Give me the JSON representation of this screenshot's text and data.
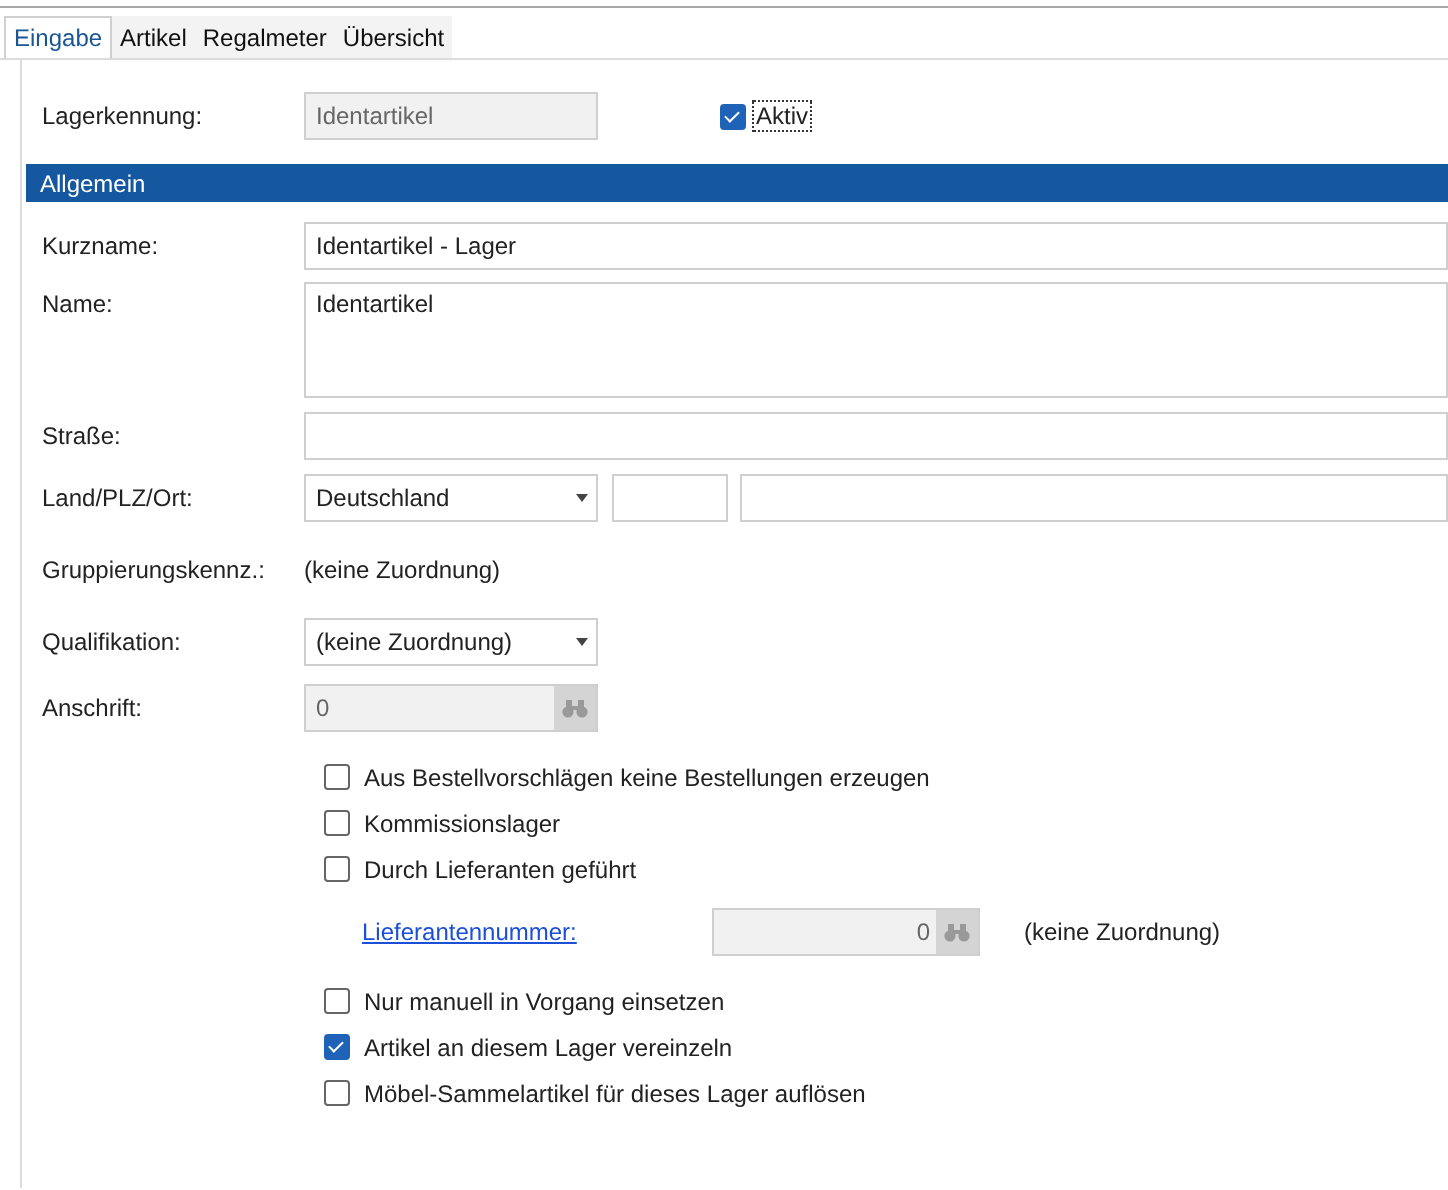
{
  "tabs": [
    {
      "label": "Eingabe",
      "selected": true
    },
    {
      "label": "Artikel",
      "selected": false
    },
    {
      "label": "Regalmeter",
      "selected": false
    },
    {
      "label": "Übersicht",
      "selected": false
    }
  ],
  "lagerkennung": {
    "label": "Lagerkennung:",
    "value": "Identartikel",
    "disabled": true
  },
  "aktiv": {
    "label": "Aktiv",
    "checked": true
  },
  "section": {
    "title": "Allgemein"
  },
  "fields": [
    {
      "kind": "text",
      "label": "Kurzname:",
      "value": "Identartikel - Lager"
    },
    {
      "kind": "textarea",
      "label": "Name:",
      "value": "Identartikel"
    },
    {
      "kind": "text",
      "label": "Straße:"
    },
    {
      "kind": "address",
      "label": "Land/PLZ/Ort:",
      "value": "Deutschland"
    },
    {
      "kind": "static",
      "label": "Gruppierungskennz.:",
      "value": "(keine Zuordnung)"
    },
    {
      "kind": "select",
      "label": "Qualifikation:",
      "value": "(keine Zuordnung)"
    },
    {
      "kind": "lookup",
      "label": "Anschrift:",
      "value": "0"
    }
  ],
  "options": [
    {
      "kind": "checkbox",
      "label": "Aus Bestellvorschlägen keine Bestellungen erzeugen",
      "checked": false
    },
    {
      "kind": "checkbox",
      "label": "Kommissionslager",
      "checked": false
    },
    {
      "kind": "checkbox",
      "label": "Durch Lieferanten geführt",
      "checked": false
    },
    {
      "kind": "link_lookup",
      "label": "Lieferantennummer:",
      "value": "0",
      "note": "(keine Zuordnung)"
    },
    {
      "kind": "checkbox",
      "label": "Nur manuell in Vorgang einsetzen",
      "checked": false
    },
    {
      "kind": "checkbox",
      "label": "Artikel an diesem Lager vereinzeln",
      "checked": true
    },
    {
      "kind": "checkbox",
      "label": "Möbel-Sammelartikel für dieses Lager auflösen",
      "checked": false
    }
  ]
}
